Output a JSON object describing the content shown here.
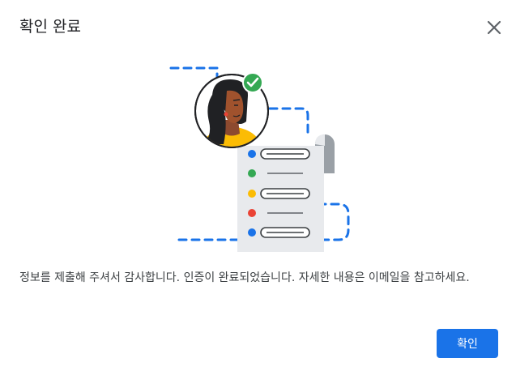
{
  "dialog": {
    "title": "확인 완료",
    "message": "정보를 제출해 주셔서 감사합니다. 인증이 완료되었습니다. 자세한 내용은 이메일을 참고하세요.",
    "confirm_label": "확인",
    "close_icon": "close-icon"
  },
  "illustration": {
    "icons": [
      "user-avatar-icon",
      "verified-check-icon",
      "document-checklist-icon"
    ],
    "colors": {
      "blue": "#1a73e8",
      "green": "#34a853",
      "yellow": "#fbbc04",
      "red": "#ea4335",
      "paper": "#e8eaed",
      "scroll": "#9aa0a6"
    }
  }
}
